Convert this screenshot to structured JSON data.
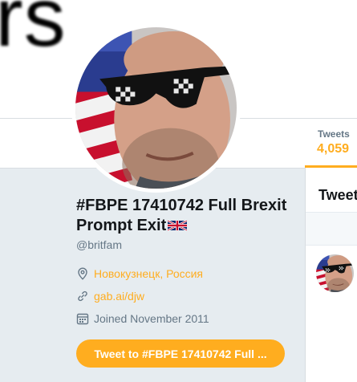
{
  "background_text": "rs",
  "nav": {
    "tweets_label": "Tweets",
    "tweets_count": "4,059"
  },
  "profile": {
    "display_name": "#FBPE 17410742 Full Brexit Prompt Exit",
    "handle": "@britfam",
    "location": "Новокузнецк, Россия",
    "url": "gab.ai/djw",
    "joined": "Joined November 2011"
  },
  "tweet_button_label": "Tweet to #FBPE 17410742 Full ...",
  "right_column": {
    "title": "Tweets"
  },
  "icons": {
    "location": "location-pin-icon",
    "link": "link-icon",
    "calendar": "calendar-icon",
    "flag": "uk-flag-icon"
  },
  "colors": {
    "accent": "#ffad1f",
    "muted": "#657786",
    "text": "#14171a",
    "bg": "#e6ecf0"
  }
}
